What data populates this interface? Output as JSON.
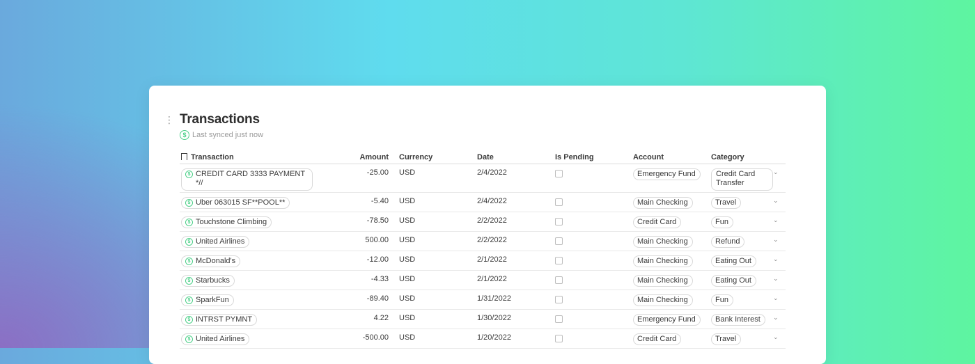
{
  "title": "Transactions",
  "sync_status": "Last synced just now",
  "columns": {
    "transaction": "Transaction",
    "amount": "Amount",
    "currency": "Currency",
    "date": "Date",
    "is_pending": "Is Pending",
    "account": "Account",
    "category": "Category"
  },
  "rows": [
    {
      "name": "CREDIT CARD 3333 PAYMENT *//",
      "amount": "-25.00",
      "currency": "USD",
      "date": "2/4/2022",
      "pending": false,
      "account": "Emergency Fund",
      "category": "Credit Card Transfer"
    },
    {
      "name": "Uber 063015 SF**POOL**",
      "amount": "-5.40",
      "currency": "USD",
      "date": "2/4/2022",
      "pending": false,
      "account": "Main Checking",
      "category": "Travel"
    },
    {
      "name": "Touchstone Climbing",
      "amount": "-78.50",
      "currency": "USD",
      "date": "2/2/2022",
      "pending": false,
      "account": "Credit Card",
      "category": "Fun"
    },
    {
      "name": "United Airlines",
      "amount": "500.00",
      "currency": "USD",
      "date": "2/2/2022",
      "pending": false,
      "account": "Main Checking",
      "category": "Refund"
    },
    {
      "name": "McDonald's",
      "amount": "-12.00",
      "currency": "USD",
      "date": "2/1/2022",
      "pending": false,
      "account": "Main Checking",
      "category": "Eating Out"
    },
    {
      "name": "Starbucks",
      "amount": "-4.33",
      "currency": "USD",
      "date": "2/1/2022",
      "pending": false,
      "account": "Main Checking",
      "category": "Eating Out"
    },
    {
      "name": "SparkFun",
      "amount": "-89.40",
      "currency": "USD",
      "date": "1/31/2022",
      "pending": false,
      "account": "Main Checking",
      "category": "Fun"
    },
    {
      "name": "INTRST PYMNT",
      "amount": "4.22",
      "currency": "USD",
      "date": "1/30/2022",
      "pending": false,
      "account": "Emergency Fund",
      "category": "Bank Interest"
    },
    {
      "name": "United Airlines",
      "amount": "-500.00",
      "currency": "USD",
      "date": "1/20/2022",
      "pending": false,
      "account": "Credit Card",
      "category": "Travel"
    }
  ],
  "icons": {
    "sync": "sync-dollar-icon",
    "transaction": "sync-dollar-icon",
    "header": "bookmark-icon",
    "row_menu": "chevron-down-icon"
  },
  "colors": {
    "accent_green": "#4fd08a"
  }
}
